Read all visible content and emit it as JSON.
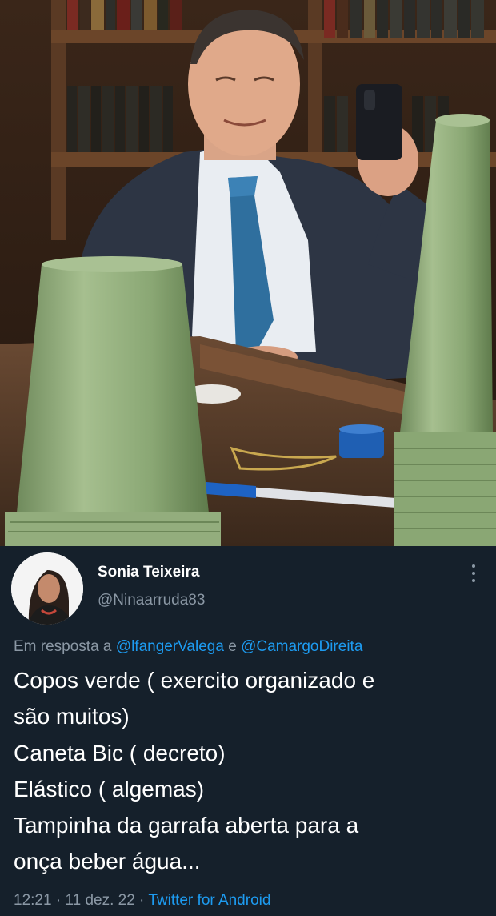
{
  "tweet": {
    "display_name": "Sonia Teixeira",
    "handle": "@Ninaarruda83",
    "reply_prefix": "Em resposta a",
    "reply_mention_1": "@lfangerValega",
    "reply_conjunction": "e",
    "reply_mention_2": "@CamargoDireita",
    "lines": [
      "Copos verde ( exercito organizado e",
      "são muitos)",
      "Caneta Bic ( decreto)",
      "Elástico ( algemas)",
      "Tampinha da garrafa aberta para a",
      "onça beber água..."
    ],
    "time": "12:21",
    "date": "11 dez. 22",
    "separator": "·",
    "source": "Twitter for Android"
  },
  "icons": {
    "more": "more-vertical-icon",
    "avatar": "avatar-photo"
  },
  "colors": {
    "background": "#15202b",
    "text_primary": "#ffffff",
    "text_secondary": "#8b98a5",
    "link": "#1d9bf0",
    "cup_green": "#8aa774"
  }
}
